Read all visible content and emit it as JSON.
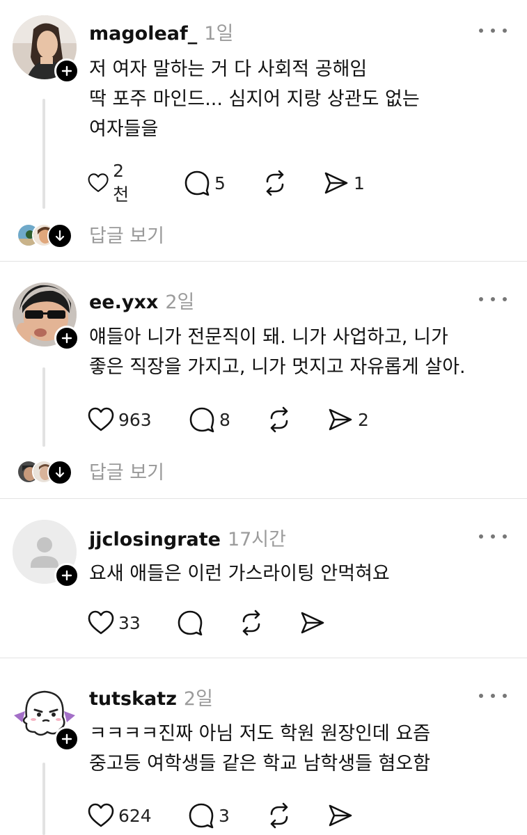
{
  "posts": [
    {
      "username": "magoleaf_",
      "time": "1일",
      "lines": [
        "저 여자 말하는 거 다 사회적 공해임",
        "딱 포주 마인드... 심지어 지랑 상관도 없는",
        "여자들을"
      ],
      "likes": "2천",
      "comments": "5",
      "reposts": "",
      "shares": "1",
      "view_replies": "답글 보기"
    },
    {
      "username": "ee.yxx",
      "time": "2일",
      "lines": [
        "얘들아 니가 전문직이 돼. 니가 사업하고, 니가",
        "좋은 직장을 가지고, 니가 멋지고 자유롭게 살아."
      ],
      "likes": "963",
      "comments": "8",
      "reposts": "",
      "shares": "2",
      "view_replies": "답글 보기"
    },
    {
      "username": "jjclosingrate",
      "time": "17시간",
      "lines": [
        "요새 애들은 이런 가스라이팅 안먹혀요"
      ],
      "likes": "33",
      "comments": "",
      "reposts": "",
      "shares": ""
    },
    {
      "username": "tutskatz",
      "time": "2일",
      "lines": [
        "ㅋㅋㅋㅋ진짜 아님 저도 학원 원장인데 요즘",
        "중고등 여학생들 같은 학교 남학생들 혐오함"
      ],
      "likes": "624",
      "comments": "3",
      "reposts": "",
      "shares": ""
    }
  ],
  "icons": {
    "like": "heart-icon",
    "comment": "comment-bubble-icon",
    "repost": "repost-icon",
    "share": "send-icon",
    "more": "more-dots-icon",
    "follow": "plus-icon",
    "expand": "arrow-down-icon"
  },
  "colors": {
    "text": "#111111",
    "muted": "#9b9b9b",
    "divider": "#e3e3e3",
    "badge": "#000000"
  }
}
